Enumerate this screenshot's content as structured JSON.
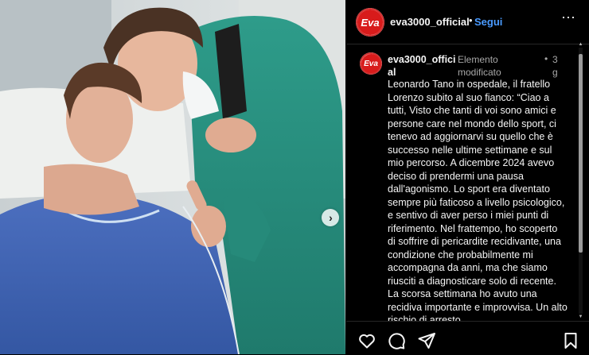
{
  "header": {
    "avatar_logo": "Eva",
    "username": "eva3000_official",
    "separator": "•",
    "follow_label": "Segui",
    "more_icon": "⋯"
  },
  "caption": {
    "avatar_logo": "Eva",
    "username": "eva3000_official",
    "edited_label": "Elemento modificato",
    "separator": "•",
    "time": "3 g",
    "text": "Leonardo Tano in ospedale, il fratello Lorenzo subito al suo fianco: “Ciao a tutti, Visto che tanti di voi sono amici e persone care nel mondo dello sport, ci tenevo ad aggiornarvi su quello che è successo nelle ultime settimane e sul mio percorso. A dicembre 2024 avevo deciso di prendermi una pausa dall'agonismo. Lo sport era diventato sempre più faticoso a livello psicologico, e sentivo di aver perso i miei punti di riferimento. Nel frattempo, ho scoperto di soffrire di pericardite recidivante, una condizione che probabilmente mi accompagna da anni, ma che siamo riusciti a diagnosticare solo di recente. La scorsa settimana ho avuto una recidiva importante e improvvisa. Un alto rischio di arresto"
  },
  "photo": {
    "next_icon": "›"
  },
  "actions": {
    "icons": [
      "heart-icon",
      "comment-icon",
      "share-icon",
      "bookmark-icon"
    ]
  },
  "colors": {
    "background": "#000000",
    "text": "#f5f5f5",
    "muted": "#a8a8a8",
    "follow": "#4a9bff",
    "brand": "#d81b1b"
  }
}
